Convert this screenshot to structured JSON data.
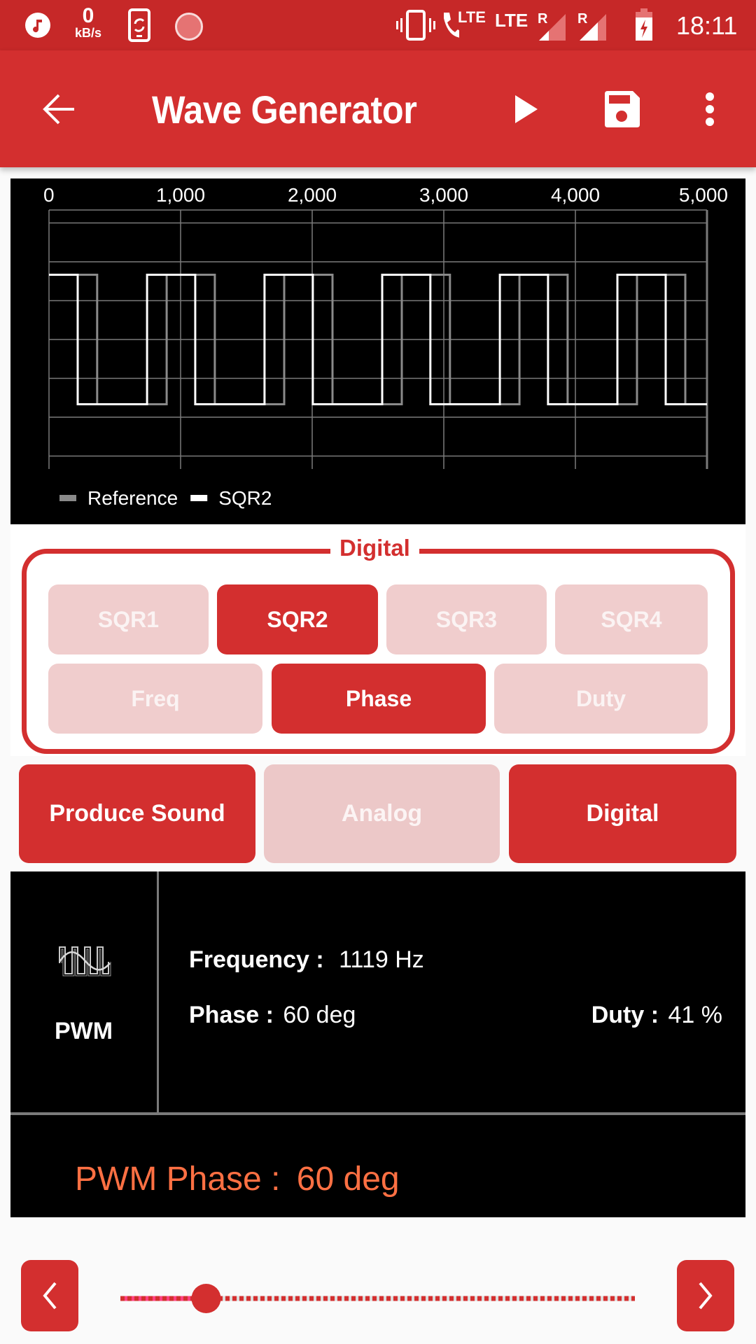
{
  "status_bar": {
    "net_speed_value": "0",
    "net_speed_unit": "kB/s",
    "network_1": "LTE",
    "network_2": "LTE",
    "roaming_1": "R",
    "roaming_2": "R",
    "time": "18:11",
    "icons": [
      "music-icon",
      "data-speed",
      "phone-sync-icon",
      "loading-circle-icon",
      "vibrate-icon",
      "volte-call-icon",
      "lte-icon",
      "signal-icon",
      "signal-icon",
      "battery-charging-icon"
    ]
  },
  "app_bar": {
    "title": "Wave Generator",
    "back_icon": "arrow-left-icon",
    "actions": [
      "play-icon",
      "save-icon",
      "more-vert-icon"
    ]
  },
  "chart_data": {
    "type": "line",
    "title": "",
    "xlabel": "",
    "ylabel": "",
    "x_unit": "microseconds",
    "xlim": [
      0,
      5000
    ],
    "ylim": [
      -2,
      2
    ],
    "x_ticks": [
      0,
      1000,
      2000,
      3000,
      4000,
      5000
    ],
    "x_tick_labels": [
      "0",
      "1,000",
      "2,000",
      "3,000",
      "4,000",
      "5,000"
    ],
    "x_tick_position": "top",
    "y_gridlines": [
      1.8,
      1.2,
      0.6,
      0,
      -0.6,
      -1.2,
      -1.8
    ],
    "grid": true,
    "legend_position": "bottom-left",
    "series": [
      {
        "name": "Reference",
        "color": "#8a8a8a",
        "high": 1,
        "low": -1,
        "frequency_hz": 1119,
        "duty_percent": 41,
        "phase_deg": 0,
        "high_intervals": [
          [
            0,
            366
          ],
          [
            894,
            1260
          ],
          [
            1787,
            2154
          ],
          [
            2681,
            3047
          ],
          [
            3575,
            3941
          ],
          [
            4468,
            4835
          ]
        ]
      },
      {
        "name": "SQR2",
        "color": "#ffffff",
        "high": 1,
        "low": -1,
        "frequency_hz": 1119,
        "duty_percent": 41,
        "phase_deg": 60,
        "high_intervals": [
          [
            0,
            218
          ],
          [
            745,
            1111
          ],
          [
            1638,
            2005
          ],
          [
            2532,
            2898
          ],
          [
            3426,
            3792
          ],
          [
            4319,
            4686
          ]
        ]
      }
    ]
  },
  "digital_section": {
    "title": "Digital",
    "channels": [
      {
        "label": "SQR1",
        "selected": false
      },
      {
        "label": "SQR2",
        "selected": true
      },
      {
        "label": "SQR3",
        "selected": false
      },
      {
        "label": "SQR4",
        "selected": false
      }
    ],
    "properties": [
      {
        "label": "Freq",
        "selected": false
      },
      {
        "label": "Phase",
        "selected": true
      },
      {
        "label": "Duty",
        "selected": false
      }
    ]
  },
  "mode_buttons": [
    {
      "label": "Produce Sound",
      "selected": true
    },
    {
      "label": "Analog",
      "selected": false
    },
    {
      "label": "Digital",
      "selected": true
    }
  ],
  "info": {
    "wave_icon": "pwm-wave-icon",
    "wave_type": "PWM",
    "frequency_label": "Frequency :",
    "frequency_value": "1119 Hz",
    "phase_label": "Phase :",
    "phase_value": "60 deg",
    "duty_label": "Duty :",
    "duty_value": "41 %",
    "readout_label": "PWM Phase :",
    "readout_value": "60 deg"
  },
  "slider": {
    "min": 0,
    "max": 360,
    "value": 60,
    "unit": "deg",
    "prev_icon": "chevron-left-icon",
    "next_icon": "chevron-right-icon"
  },
  "colors": {
    "status_bar": "#c62828",
    "primary": "#d32f2f",
    "primary_light": "#f0cdcd",
    "accent": "#ff4081",
    "readout": "#ff7043"
  }
}
